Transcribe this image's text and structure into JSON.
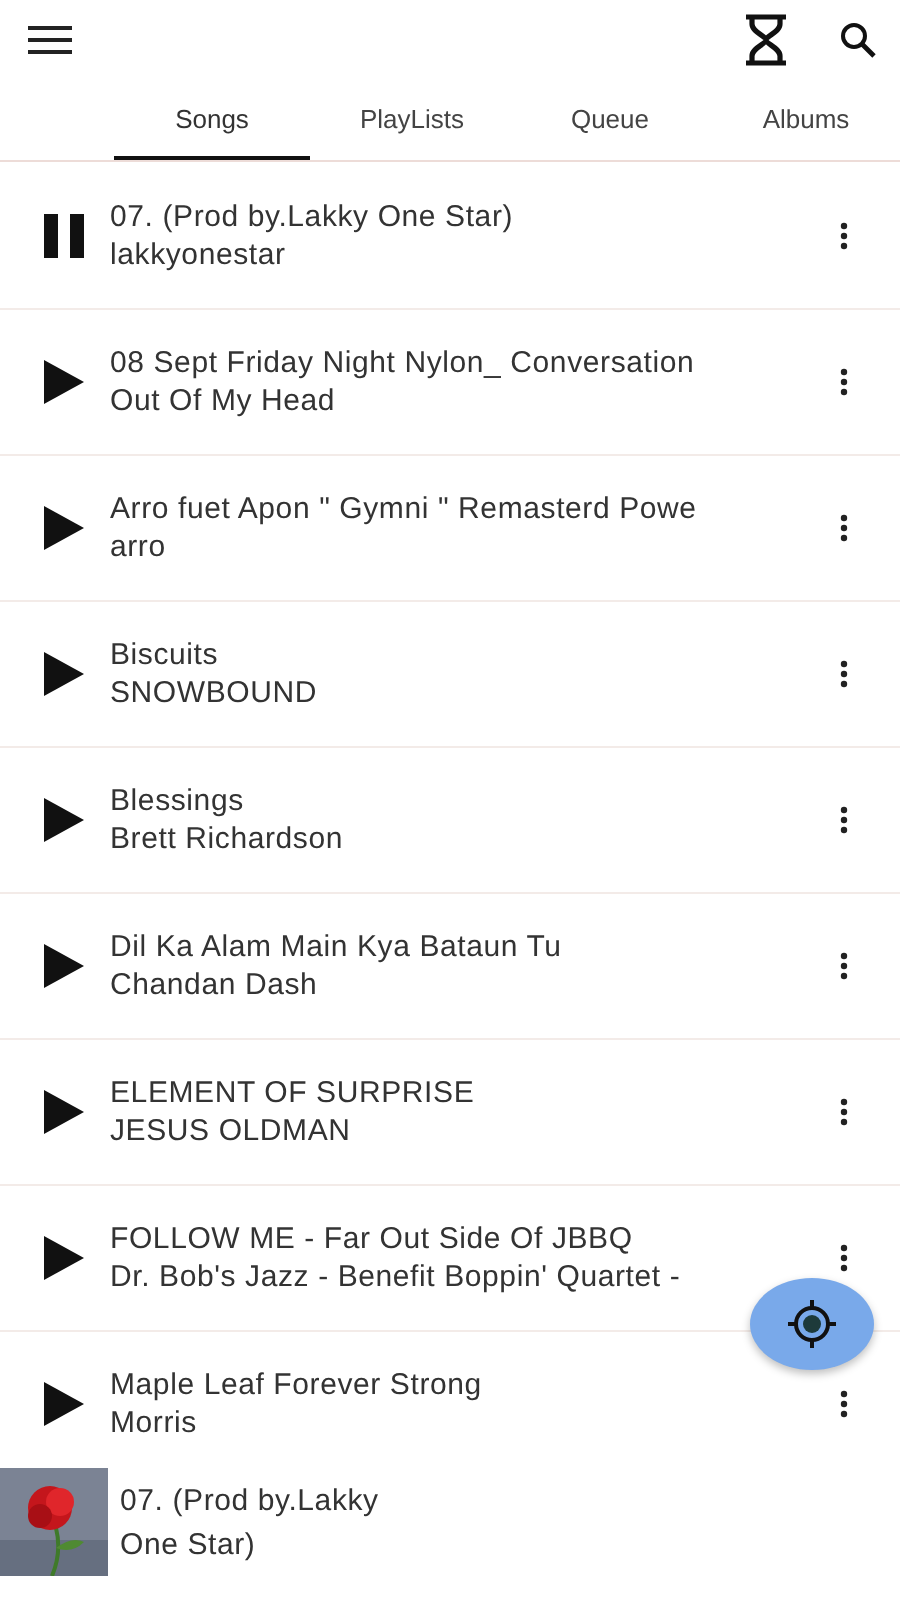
{
  "tabs": [
    {
      "label": "Songs",
      "selected": true
    },
    {
      "label": "PlayLists",
      "selected": false
    },
    {
      "label": "Queue",
      "selected": false
    },
    {
      "label": "Albums",
      "selected": false
    }
  ],
  "songs": [
    {
      "title": "07.  (Prod by.Lakky One Star)",
      "artist": "lakkyonestar",
      "playing": true
    },
    {
      "title": "08 Sept Friday Night Nylon_ Conversation",
      "artist": "Out Of My Head",
      "playing": false
    },
    {
      "title": "Arro fuet Apon \" Gymni \" Remasterd Powe",
      "artist": "arro",
      "playing": false
    },
    {
      "title": "Biscuits",
      "artist": "SNOWBOUND",
      "playing": false
    },
    {
      "title": "Blessings",
      "artist": "Brett Richardson",
      "playing": false
    },
    {
      "title": "Dil Ka Alam Main Kya Bataun Tu",
      "artist": "Chandan Dash",
      "playing": false
    },
    {
      "title": "ELEMENT OF SURPRISE",
      "artist": "JESUS OLDMAN",
      "playing": false
    },
    {
      "title": "FOLLOW ME - Far Out Side Of JBBQ",
      "artist": "Dr. Bob's Jazz - Benefit Boppin' Quartet -",
      "playing": false
    },
    {
      "title": "Maple Leaf Forever Strong",
      "artist": "Morris",
      "playing": false
    }
  ],
  "now_playing": {
    "title": "07.  (Prod by.Lakky One Star)"
  }
}
